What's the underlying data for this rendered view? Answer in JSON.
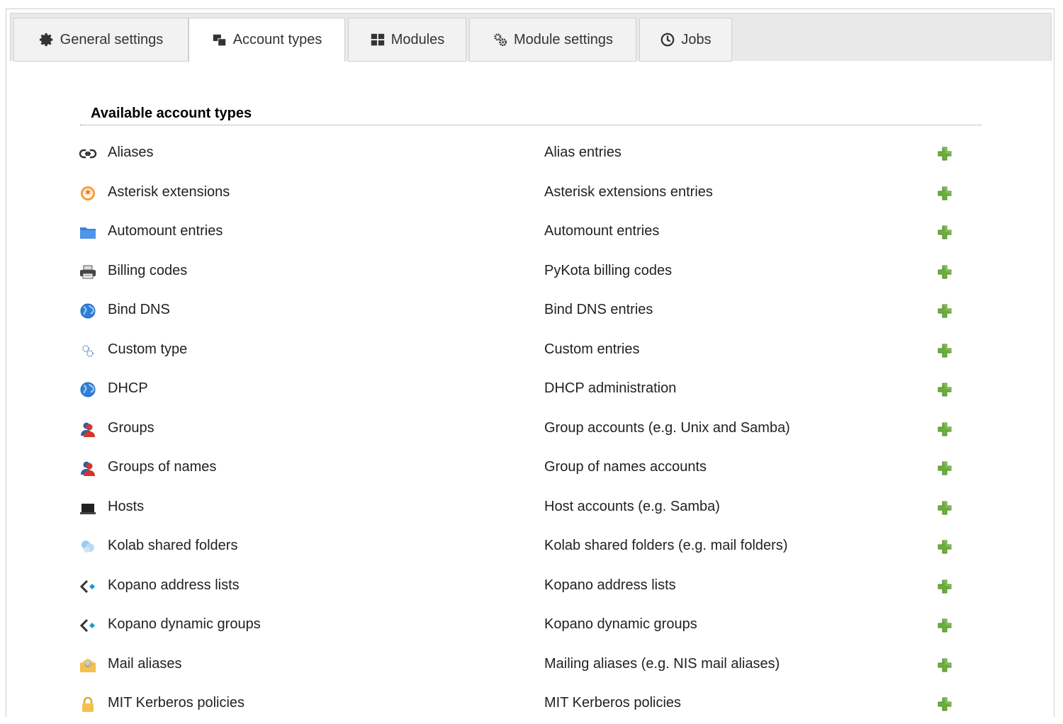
{
  "tabs": [
    {
      "label": "General settings",
      "icon": "gear-icon",
      "active": false
    },
    {
      "label": "Account types",
      "icon": "windows-icon",
      "active": true
    },
    {
      "label": "Modules",
      "icon": "grid-icon",
      "active": false
    },
    {
      "label": "Module settings",
      "icon": "gears-icon",
      "active": false
    },
    {
      "label": "Jobs",
      "icon": "clock-icon",
      "active": false
    }
  ],
  "section": {
    "title": "Available account types"
  },
  "colors": {
    "add": "#5aa02c",
    "link": "#333333",
    "blue": "#3b82d6"
  },
  "account_types": [
    {
      "name": "Aliases",
      "description": "Alias entries",
      "icon": "link-icon"
    },
    {
      "name": "Asterisk extensions",
      "description": "Asterisk extensions entries",
      "icon": "asterisk-icon"
    },
    {
      "name": "Automount entries",
      "description": "Automount entries",
      "icon": "folder-icon"
    },
    {
      "name": "Billing codes",
      "description": "PyKota billing codes",
      "icon": "printer-icon"
    },
    {
      "name": "Bind DNS",
      "description": "Bind DNS entries",
      "icon": "globe-icon"
    },
    {
      "name": "Custom type",
      "description": "Custom entries",
      "icon": "gears-icon"
    },
    {
      "name": "DHCP",
      "description": "DHCP administration",
      "icon": "globe-icon"
    },
    {
      "name": "Groups",
      "description": "Group accounts (e.g. Unix and Samba)",
      "icon": "group-icon"
    },
    {
      "name": "Groups of names",
      "description": "Group of names accounts",
      "icon": "group-icon"
    },
    {
      "name": "Hosts",
      "description": "Host accounts (e.g. Samba)",
      "icon": "laptop-icon"
    },
    {
      "name": "Kolab shared folders",
      "description": "Kolab shared folders (e.g. mail folders)",
      "icon": "kolab-icon"
    },
    {
      "name": "Kopano address lists",
      "description": "Kopano address lists",
      "icon": "kopano-icon"
    },
    {
      "name": "Kopano dynamic groups",
      "description": "Kopano dynamic groups",
      "icon": "kopano-icon"
    },
    {
      "name": "Mail aliases",
      "description": "Mailing aliases (e.g. NIS mail aliases)",
      "icon": "mail-icon"
    },
    {
      "name": "MIT Kerberos policies",
      "description": "MIT Kerberos policies",
      "icon": "lock-icon"
    }
  ]
}
